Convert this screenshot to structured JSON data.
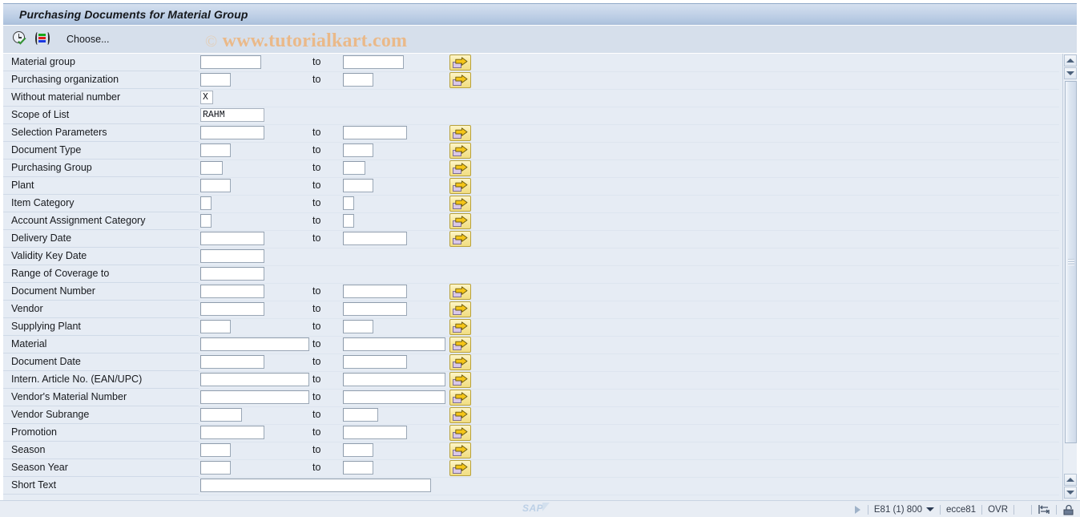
{
  "window": {
    "title": "Purchasing Documents for Material Group"
  },
  "toolbar": {
    "execute_icon": "execute-clock-icon",
    "variant_icon": "variant-selection-icon",
    "choose_label": "Choose..."
  },
  "watermark": {
    "copyright": "©",
    "text": "www.tutorialkart.com"
  },
  "form": {
    "to_label": "to",
    "select_button_icon": "multiple-selection-arrow-icon",
    "rows": [
      {
        "label": "Material group",
        "from": "",
        "from_w": 76,
        "has_to": true,
        "to_w": 76,
        "has_btn": true
      },
      {
        "label": "Purchasing organization",
        "from": "",
        "from_w": 38,
        "has_to": true,
        "to_w": 38,
        "has_btn": true
      },
      {
        "label": "Without material number",
        "from": "X",
        "from_w": 16,
        "has_to": false,
        "to_w": 0,
        "has_btn": false
      },
      {
        "label": "Scope of List",
        "from": "RAHM",
        "from_w": 80,
        "has_to": false,
        "to_w": 0,
        "has_btn": false
      },
      {
        "label": "Selection Parameters",
        "from": "",
        "from_w": 80,
        "has_to": true,
        "to_w": 80,
        "has_btn": true
      },
      {
        "label": "Document Type",
        "from": "",
        "from_w": 38,
        "has_to": true,
        "to_w": 38,
        "has_btn": true
      },
      {
        "label": "Purchasing Group",
        "from": "",
        "from_w": 28,
        "has_to": true,
        "to_w": 28,
        "has_btn": true
      },
      {
        "label": "Plant",
        "from": "",
        "from_w": 38,
        "has_to": true,
        "to_w": 38,
        "has_btn": true
      },
      {
        "label": "Item Category",
        "from": "",
        "from_w": 14,
        "has_to": true,
        "to_w": 14,
        "has_btn": true
      },
      {
        "label": "Account Assignment Category",
        "from": "",
        "from_w": 14,
        "has_to": true,
        "to_w": 14,
        "has_btn": true
      },
      {
        "label": "Delivery Date",
        "from": "",
        "from_w": 80,
        "has_to": true,
        "to_w": 80,
        "has_btn": true
      },
      {
        "label": "Validity Key Date",
        "from": "",
        "from_w": 80,
        "has_to": false,
        "to_w": 0,
        "has_btn": false
      },
      {
        "label": "Range of Coverage to",
        "from": "",
        "from_w": 80,
        "has_to": false,
        "to_w": 0,
        "has_btn": false
      },
      {
        "label": "Document Number",
        "from": "",
        "from_w": 80,
        "has_to": true,
        "to_w": 80,
        "has_btn": true
      },
      {
        "label": "Vendor",
        "from": "",
        "from_w": 80,
        "has_to": true,
        "to_w": 80,
        "has_btn": true
      },
      {
        "label": "Supplying Plant",
        "from": "",
        "from_w": 38,
        "has_to": true,
        "to_w": 38,
        "has_btn": true
      },
      {
        "label": "Material",
        "from": "",
        "from_w": 136,
        "has_to": true,
        "to_w": 128,
        "has_btn": true
      },
      {
        "label": "Document Date",
        "from": "",
        "from_w": 80,
        "has_to": true,
        "to_w": 80,
        "has_btn": true
      },
      {
        "label": "Intern. Article No. (EAN/UPC)",
        "from": "",
        "from_w": 136,
        "has_to": true,
        "to_w": 128,
        "has_btn": true
      },
      {
        "label": "Vendor's Material Number",
        "from": "",
        "from_w": 136,
        "has_to": true,
        "to_w": 128,
        "has_btn": true
      },
      {
        "label": "Vendor Subrange",
        "from": "",
        "from_w": 52,
        "has_to": true,
        "to_w": 44,
        "has_btn": true
      },
      {
        "label": "Promotion",
        "from": "",
        "from_w": 80,
        "has_to": true,
        "to_w": 80,
        "has_btn": true
      },
      {
        "label": "Season",
        "from": "",
        "from_w": 38,
        "has_to": true,
        "to_w": 38,
        "has_btn": true
      },
      {
        "label": "Season Year",
        "from": "",
        "from_w": 38,
        "has_to": true,
        "to_w": 38,
        "has_btn": true
      },
      {
        "label": "Short Text",
        "from": "",
        "from_w": 288,
        "has_to": false,
        "to_w": 0,
        "has_btn": false
      }
    ]
  },
  "scrollbar": {
    "up_icon": "scroll-up-arrow-icon",
    "down_icon": "scroll-down-arrow-icon"
  },
  "statusbar": {
    "logo": "SAP",
    "play_icon": "status-play-icon",
    "system": "E81 (1) 800",
    "caret_icon": "chevron-down-icon",
    "server": "ecce81",
    "insert_mode": "OVR",
    "transfer_icon": "data-transfer-icon",
    "lock_icon": "session-lock-icon"
  },
  "colors": {
    "title_gradient_top": "#d5e0ef",
    "title_gradient_bottom": "#a9bed9",
    "toolbar_bg": "#d6dfeb",
    "form_bg": "#e6ecf4",
    "button_yellow": "#f7e79a",
    "watermark": "#eab989"
  }
}
